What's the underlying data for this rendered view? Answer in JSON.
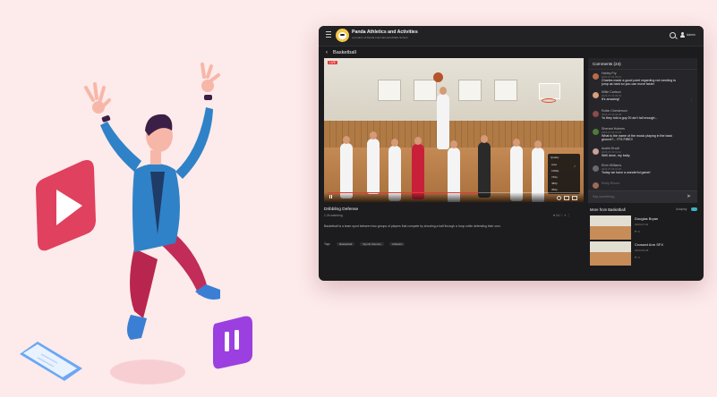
{
  "app": {
    "title": "Panda Athletics and Activities",
    "subtitle": "a product of Panda International Middle School",
    "user_label": "Admin",
    "page_title": "Basketball"
  },
  "icons": {
    "menu": "menu-icon",
    "logo": "panda-logo",
    "search": "search-icon",
    "user": "user-icon",
    "back": "chevron-left-icon",
    "play_pause": "pause-icon",
    "settings": "gear-icon",
    "subtitles": "subtitles-icon",
    "fullscreen": "fullscreen-icon",
    "send": "send-icon"
  },
  "colors": {
    "accent_live": "#e53935",
    "toggle": "#3bb3c3",
    "background": "#fdeaea",
    "window": "#1c1c1e"
  },
  "video": {
    "live_badge": "LIVE",
    "progress": 0.6,
    "quality_menu": {
      "heading": "Quality",
      "options": [
        "Auto",
        "1080p",
        "720p",
        "480p",
        "360p"
      ],
      "selected": "Auto"
    },
    "title": "Dribbling Defense",
    "views": "1.2k watching",
    "actions": "♥ 14   ♡   ↗  ⋮",
    "description": "Basketball is a team sport between two groups of players that compete by shooting a ball through a hoop while defending their own.",
    "tags_label": "Tags",
    "tags": [
      "Basketball",
      "Sports Science",
      "Athletics"
    ]
  },
  "comments": {
    "heading": "Comments (24)",
    "items": [
      {
        "name": "Harley Fry",
        "date": "2023-07-03 09:21",
        "text": "Charles made a good point regarding not needing to",
        "text2": "jump as hard so you can move faster",
        "avatar": "#b66d4c"
      },
      {
        "name": "Millie Carlson",
        "date": "2023-07-03 09:33",
        "text": "It's amazing!",
        "text2": "",
        "avatar": "#d9a07a"
      },
      {
        "name": "Robin Chesterson",
        "date": "2023-07-03 09:48",
        "text": "Yo they told a guy 20 ain't tall enough...",
        "text2": "",
        "avatar": "#8c4b4b"
      },
      {
        "name": "Sherard Holmes",
        "date": "2023-07-03 10:05",
        "text": "What is the name of the music playing in the back",
        "text2": "ground?... IT'S FIRE!!",
        "avatar": "#4f7a3a"
      },
      {
        "name": "Austin Ercoli",
        "date": "2023-07-03 10:12",
        "text": "Well done, my baby",
        "text2": "",
        "avatar": "#c7a29a"
      },
      {
        "name": "Elvin Williams",
        "date": "2023-07-03 10:20",
        "text": "Today we have a wonderful game!",
        "text2": "",
        "avatar": "#6a6a6a"
      },
      {
        "name": "Emily Rhune",
        "date": "",
        "text": "",
        "text2": "",
        "avatar": "#9d6a58"
      }
    ],
    "input_placeholder": "Say something..."
  },
  "more": {
    "heading": "More from Basketball",
    "autoplay_label": "Autoplay",
    "autoplay_on": true,
    "items": [
      {
        "title": "Douglas Bryan",
        "subtitle": "2023-07-01",
        "icons": "♥  ⋖"
      },
      {
        "title": "Crossed Arm SFX",
        "subtitle": "2023-06-28",
        "icons": "♥  ⋖"
      }
    ]
  }
}
